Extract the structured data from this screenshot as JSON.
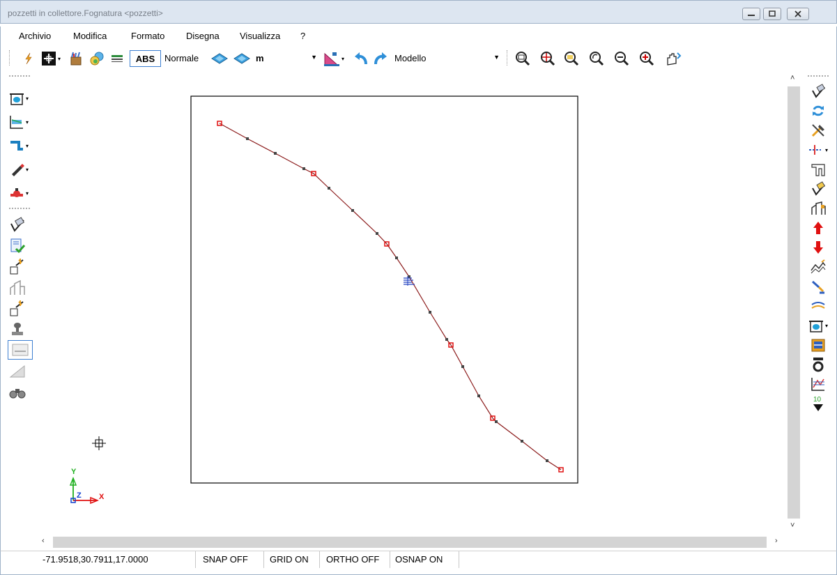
{
  "window": {
    "title": "pozzetti in collettore.Fognatura <pozzetti>"
  },
  "menu": {
    "items": [
      "Archivio",
      "Modifica",
      "Formato",
      "Disegna",
      "Visualizza",
      "?"
    ]
  },
  "toolbar": {
    "abs_label": "ABS",
    "style_label": "Normale",
    "unit_select": "m",
    "space_select": "Modello",
    "icons": [
      "lightning-icon",
      "snap-mode-icon",
      "paint-bucket-icon",
      "layers-icon",
      "lineweight-icon",
      "layer-icon-1",
      "layer-icon-2",
      "ruler-triangle-icon",
      "undo-icon",
      "redo-icon",
      "zoom-window-icon",
      "zoom-center-icon",
      "zoom-extents-icon",
      "zoom-previous-icon",
      "zoom-out-icon",
      "zoom-in-icon",
      "pan-icon"
    ]
  },
  "drawing": {
    "axis_labels": {
      "y": "Y",
      "z": "Z",
      "x": "X"
    }
  },
  "status": {
    "coordinates": "-71.9518,30.7911,17.0000",
    "snap": "SNAP OFF",
    "grid": "GRID ON",
    "ortho": "ORTHO OFF",
    "osnap": "OSNAP ON"
  },
  "colors": {
    "polyline": "#8b1a1a",
    "manhole_marker": "#e01010",
    "vertex_marker": "#333333",
    "frame": "#000000",
    "titlebar": "#dde6f1"
  }
}
